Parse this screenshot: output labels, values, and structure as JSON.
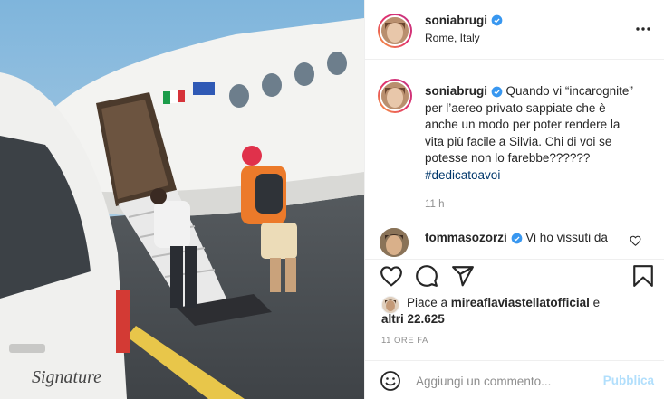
{
  "post": {
    "author": "soniabrugi",
    "location": "Rome, Italy",
    "caption_prefix": "Quando vi “incarognite”",
    "caption_lines": [
      "per l’aereo privato sappiate che è",
      "anche un modo per poter rendere la",
      "vita più facile a Silvia. Chi di voi se",
      "potesse non lo farebbe??????"
    ],
    "hashtag": "#dedicatoavoi",
    "caption_time": "11 h"
  },
  "comment": {
    "author": "tommasozorzi",
    "text": "Vi ho vissuti da"
  },
  "likes": {
    "prefix": "Piace a",
    "user": "mireaflaviastellatofficial",
    "conjunction": "e",
    "others": "altri 22.625"
  },
  "time_ago": "11 ORE FA",
  "add_comment": {
    "placeholder": "Aggiungi un commento...",
    "publish_label": "Pubblica"
  },
  "icons": {
    "verified": "verified-badge-icon",
    "more": "more-options-icon",
    "like": "heart-icon",
    "comment": "comment-bubble-icon",
    "share": "paper-plane-icon",
    "save": "bookmark-icon",
    "emoji": "smiley-icon"
  },
  "colors": {
    "link": "#00376b",
    "verified": "#3897f0",
    "publish_disabled": "#b2dffc",
    "muted": "#8e8e8e"
  }
}
